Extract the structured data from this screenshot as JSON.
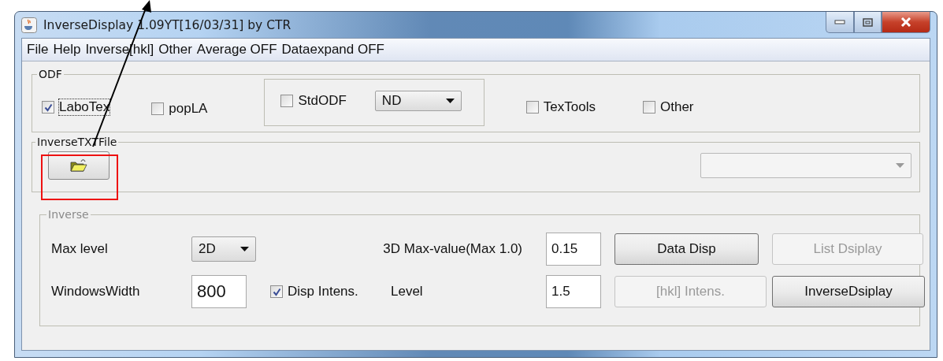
{
  "window": {
    "title": "InverseDisplay 1.09YT[16/03/31] by CTR"
  },
  "menu": [
    "File",
    "Help",
    "Inverse[hkl]",
    "Other",
    "Average OFF",
    "Dataexpand OFF"
  ],
  "odf": {
    "title": "ODF",
    "options": [
      {
        "kind": "check",
        "label": "LaboTex",
        "checked": true,
        "focused": true
      },
      {
        "kind": "check",
        "label": "popLA",
        "checked": false,
        "focused": false
      },
      {
        "kind": "std",
        "label": "StdODF",
        "checked": false,
        "focused": false,
        "format": "ND"
      },
      {
        "kind": "check",
        "label": "TexTools",
        "checked": false,
        "focused": false
      },
      {
        "kind": "check",
        "label": "Other",
        "checked": false,
        "focused": false
      }
    ]
  },
  "file": {
    "title": "InverseTXTFile"
  },
  "inverse": {
    "title": "Inverse",
    "max_level": {
      "label": "Max level",
      "value": "2D"
    },
    "windows_width": {
      "label": "WindowsWidth",
      "value": "800"
    },
    "disp_intens": {
      "label": "Disp Intens.",
      "checked": true
    },
    "max_value": {
      "label": "3D Max-value(Max 1.0)",
      "value": "0.15"
    },
    "level": {
      "label": "Level",
      "value": "1.5"
    },
    "buttons": [
      {
        "label": "Data Disp",
        "disabled": false
      },
      {
        "label": "List Dsiplay",
        "disabled": true
      },
      {
        "label": "[hkl] Intens.",
        "disabled": true
      },
      {
        "label": "InverseDsiplay",
        "disabled": false
      }
    ]
  }
}
